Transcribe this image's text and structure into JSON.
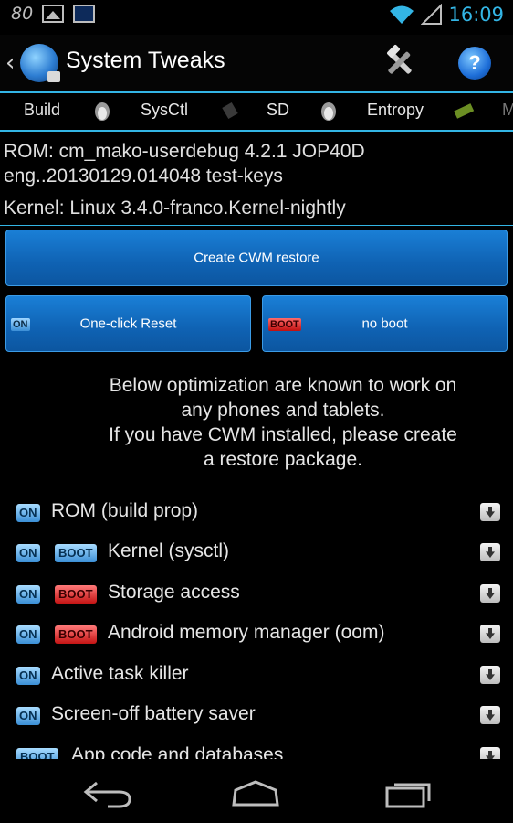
{
  "status_bar": {
    "left_text": "80",
    "icons": [
      "image-icon",
      "laptop-icon"
    ],
    "time": "16:09",
    "right_icons": [
      "wifi-icon",
      "signal-icon"
    ]
  },
  "action_bar": {
    "title": "System Tweaks",
    "back_icon": "chevron-left-icon",
    "app_icon": "system-tweaks-logo",
    "tools_icon": "tools-icon",
    "help_icon": "help-icon",
    "help_glyph": "?"
  },
  "tabs": [
    {
      "label": "Build"
    },
    {
      "label": "SysCtl"
    },
    {
      "label": "SD"
    },
    {
      "label": "Entropy"
    },
    {
      "label": "M"
    }
  ],
  "info": {
    "rom_line1": "ROM: cm_mako-userdebug 4.2.1 JOP40D",
    "rom_line2": "eng..20130129.014048 test-keys",
    "kernel": "Kernel: Linux 3.4.0-franco.Kernel-nightly"
  },
  "buttons": {
    "create_cwm": "Create CWM restore",
    "one_click_reset": "One-click Reset",
    "one_click_badge": "ON",
    "no_boot": "no boot",
    "no_boot_badge": "BOOT"
  },
  "note": {
    "line1": "Below optimization are known to work on",
    "line2": "any phones and tablets.",
    "line3": "If you have CWM installed, please create",
    "line4": "a restore package."
  },
  "badges": {
    "on": "ON",
    "boot": "BOOT"
  },
  "list": [
    {
      "label": "ROM (build prop)",
      "on": true,
      "boot": false
    },
    {
      "label": "Kernel (sysctl)",
      "on": true,
      "boot": "blue"
    },
    {
      "label": "Storage access",
      "on": true,
      "boot": "red"
    },
    {
      "label": "Android memory manager (oom)",
      "on": true,
      "boot": "red"
    },
    {
      "label": "Active task killer",
      "on": true,
      "boot": false
    },
    {
      "label": "Screen-off battery saver",
      "on": true,
      "boot": false
    },
    {
      "label": "App code and databases",
      "on": false,
      "boot": "blue"
    }
  ],
  "nav": {
    "back": "back-icon",
    "home": "home-icon",
    "recents": "recents-icon"
  },
  "colors": {
    "accent": "#33b5e5",
    "button": "#1266b8",
    "boot_badge": "#c41414"
  }
}
